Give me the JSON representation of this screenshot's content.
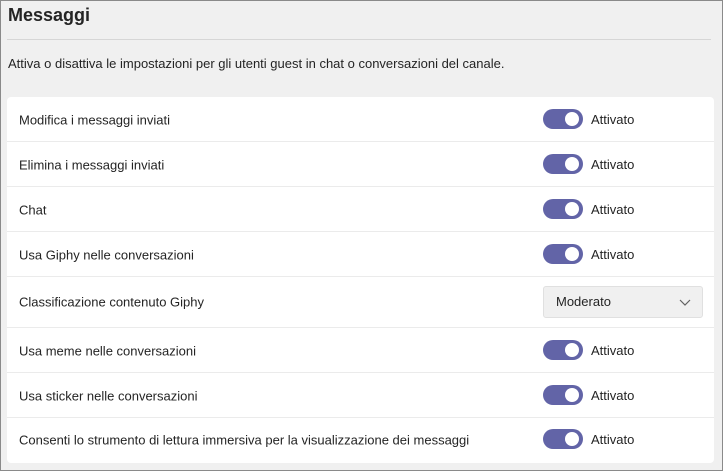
{
  "section": {
    "title": "Messaggi",
    "description": "Attiva o disattiva le impostazioni per gli utenti guest in chat o conversazioni del canale."
  },
  "settings": [
    {
      "label": "Modifica i messaggi inviati",
      "type": "toggle",
      "state": "Attivato",
      "on": true
    },
    {
      "label": "Elimina i messaggi inviati",
      "type": "toggle",
      "state": "Attivato",
      "on": true
    },
    {
      "label": "Chat",
      "type": "toggle",
      "state": "Attivato",
      "on": true
    },
    {
      "label": "Usa Giphy nelle conversazioni",
      "type": "toggle",
      "state": "Attivato",
      "on": true
    },
    {
      "label": "Classificazione contenuto Giphy",
      "type": "dropdown",
      "value": "Moderato"
    },
    {
      "label": "Usa meme nelle conversazioni",
      "type": "toggle",
      "state": "Attivato",
      "on": true
    },
    {
      "label": "Usa sticker nelle conversazioni",
      "type": "toggle",
      "state": "Attivato",
      "on": true
    },
    {
      "label": "Consenti lo strumento di lettura immersiva per la visualizzazione dei messaggi",
      "type": "toggle",
      "state": "Attivato",
      "on": true
    }
  ],
  "colors": {
    "toggle_on": "#6264a7"
  },
  "icons": {
    "dropdown": "chevron-down-icon"
  }
}
